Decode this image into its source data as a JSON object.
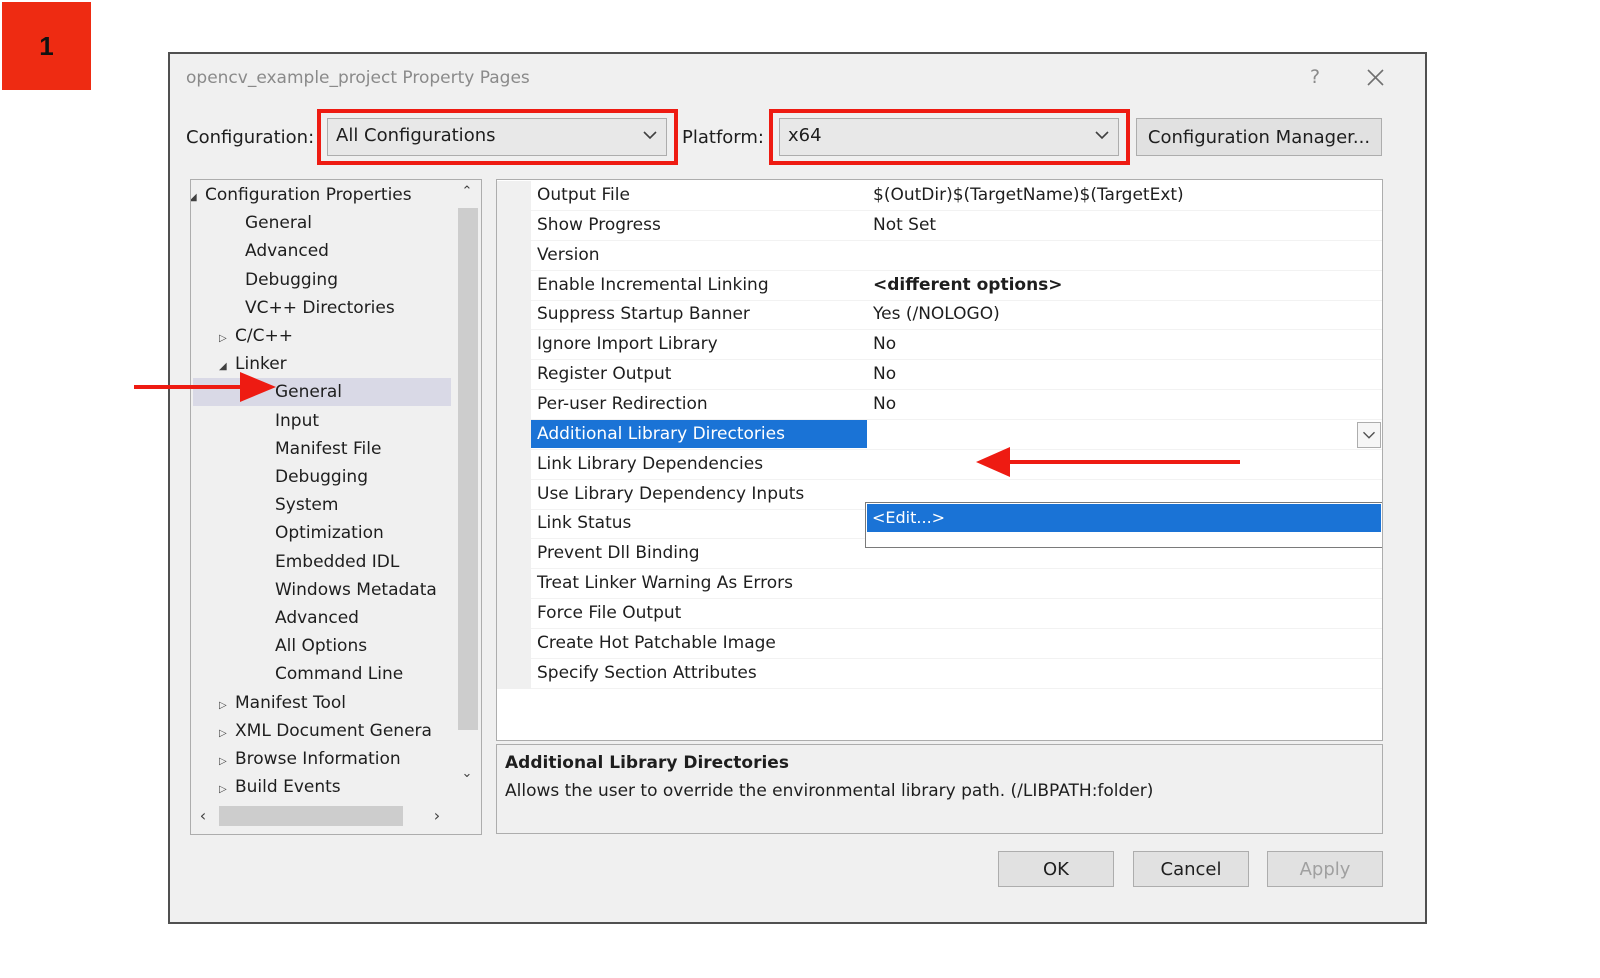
{
  "step_badge": "1",
  "dialog": {
    "title": "opencv_example_project Property Pages",
    "help_label": "?"
  },
  "toolbar": {
    "configuration_label": "Configuration:",
    "configuration_value": "All Configurations",
    "platform_label": "Platform:",
    "platform_value": "x64",
    "config_manager_label": "Configuration Manager..."
  },
  "tree": {
    "items": [
      {
        "label": "Configuration Properties",
        "expander": "expanded"
      },
      {
        "label": "General",
        "expander": ""
      },
      {
        "label": "Advanced",
        "expander": ""
      },
      {
        "label": "Debugging",
        "expander": ""
      },
      {
        "label": "VC++ Directories",
        "expander": ""
      },
      {
        "label": "C/C++",
        "expander": "collapsed"
      },
      {
        "label": "Linker",
        "expander": "expanded"
      },
      {
        "label": "General",
        "expander": ""
      },
      {
        "label": "Input",
        "expander": ""
      },
      {
        "label": "Manifest File",
        "expander": ""
      },
      {
        "label": "Debugging",
        "expander": ""
      },
      {
        "label": "System",
        "expander": ""
      },
      {
        "label": "Optimization",
        "expander": ""
      },
      {
        "label": "Embedded IDL",
        "expander": ""
      },
      {
        "label": "Windows Metadata",
        "expander": ""
      },
      {
        "label": "Advanced",
        "expander": ""
      },
      {
        "label": "All Options",
        "expander": ""
      },
      {
        "label": "Command Line",
        "expander": ""
      },
      {
        "label": "Manifest Tool",
        "expander": "collapsed"
      },
      {
        "label": "XML Document Genera",
        "expander": "collapsed"
      },
      {
        "label": "Browse Information",
        "expander": "collapsed"
      },
      {
        "label": "Build Events",
        "expander": "collapsed"
      }
    ],
    "selected_label": "Linker > General"
  },
  "properties": [
    {
      "name": "Output File",
      "value": "$(OutDir)$(TargetName)$(TargetExt)"
    },
    {
      "name": "Show Progress",
      "value": "Not Set"
    },
    {
      "name": "Version",
      "value": ""
    },
    {
      "name": "Enable Incremental Linking",
      "value": "<different options>"
    },
    {
      "name": "Suppress Startup Banner",
      "value": "Yes (/NOLOGO)"
    },
    {
      "name": "Ignore Import Library",
      "value": "No"
    },
    {
      "name": "Register Output",
      "value": "No"
    },
    {
      "name": "Per-user Redirection",
      "value": "No"
    },
    {
      "name": "Additional Library Directories",
      "value": ""
    },
    {
      "name": "Link Library Dependencies",
      "value": ""
    },
    {
      "name": "Use Library Dependency Inputs",
      "value": ""
    },
    {
      "name": "Link Status",
      "value": ""
    },
    {
      "name": "Prevent Dll Binding",
      "value": ""
    },
    {
      "name": "Treat Linker Warning As Errors",
      "value": ""
    },
    {
      "name": "Force File Output",
      "value": ""
    },
    {
      "name": "Create Hot Patchable Image",
      "value": ""
    },
    {
      "name": "Specify Section Attributes",
      "value": ""
    }
  ],
  "dropdown": {
    "item": "<Edit...>"
  },
  "description": {
    "title": "Additional Library Directories",
    "body": "Allows the user to override the environmental library path. (/LIBPATH:folder)"
  },
  "buttons": {
    "ok": "OK",
    "cancel": "Cancel",
    "apply": "Apply"
  },
  "colors": {
    "highlight_blue": "#1a73d6",
    "annotation_red": "#ee1b12",
    "tree_selection": "#d9d9e6"
  }
}
